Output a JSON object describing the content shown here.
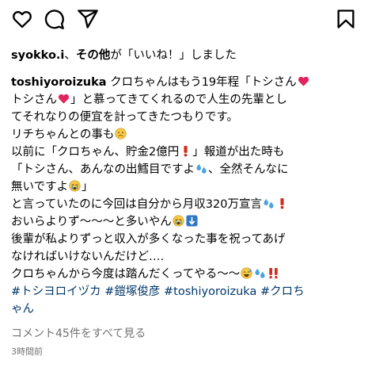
{
  "actions": {
    "icons": [
      "heart-icon",
      "comment-icon",
      "share-icon",
      "bookmark-icon"
    ]
  },
  "likes": {
    "user": "syokko.i",
    "sep": "、",
    "others": "その他",
    "rest": "が「いいね！」しました"
  },
  "caption": {
    "username": "toshiyoroizuka",
    "l1": " クロちゃんはもう19年程「トシさん",
    "l2a": "トシさん",
    "l2b": "」と慕ってきてくれるので人生の先輩とし",
    "l3": "てそれなりの便宜を計ってきたつもりです。",
    "l4": "リチちゃんとの事も",
    "l5a": "以前に「クロちゃん、貯金2億円",
    "l5b": "」報道が出た時も",
    "l6a": "「トシさん、あんなの出鱈目ですよ",
    "l6b": "、全然そんなに",
    "l7a": "無いですよ",
    "l7b": "」",
    "l8": "と言っていたのに今回は自分から月収320万宣言",
    "l9": "おいらよりず〜〜〜と多いやん",
    "l10": "後輩が私よりずっと収入が多くなった事を祝ってあげ",
    "l11": "なければいけないんだけど‥‥",
    "l12": "クロちゃんから今度は踏んだくってやる〜〜",
    "tag1": "#トシヨロイヅカ",
    "tag2": "#鎧塚俊彦",
    "tag3": "#toshiyoroizuka",
    "tag4a": "#クロち",
    "tag4b": "ゃん"
  },
  "comments": {
    "label": "コメント45件をすべて見る"
  },
  "time": {
    "label": "3時間前"
  },
  "colors": {
    "text": "#000000",
    "muted": "#737373",
    "hashtag": "#00376b",
    "heart": "#e0245e",
    "exclaim": "#d62b1f",
    "sweat": "#4aa3df",
    "face": "#f7c948"
  }
}
